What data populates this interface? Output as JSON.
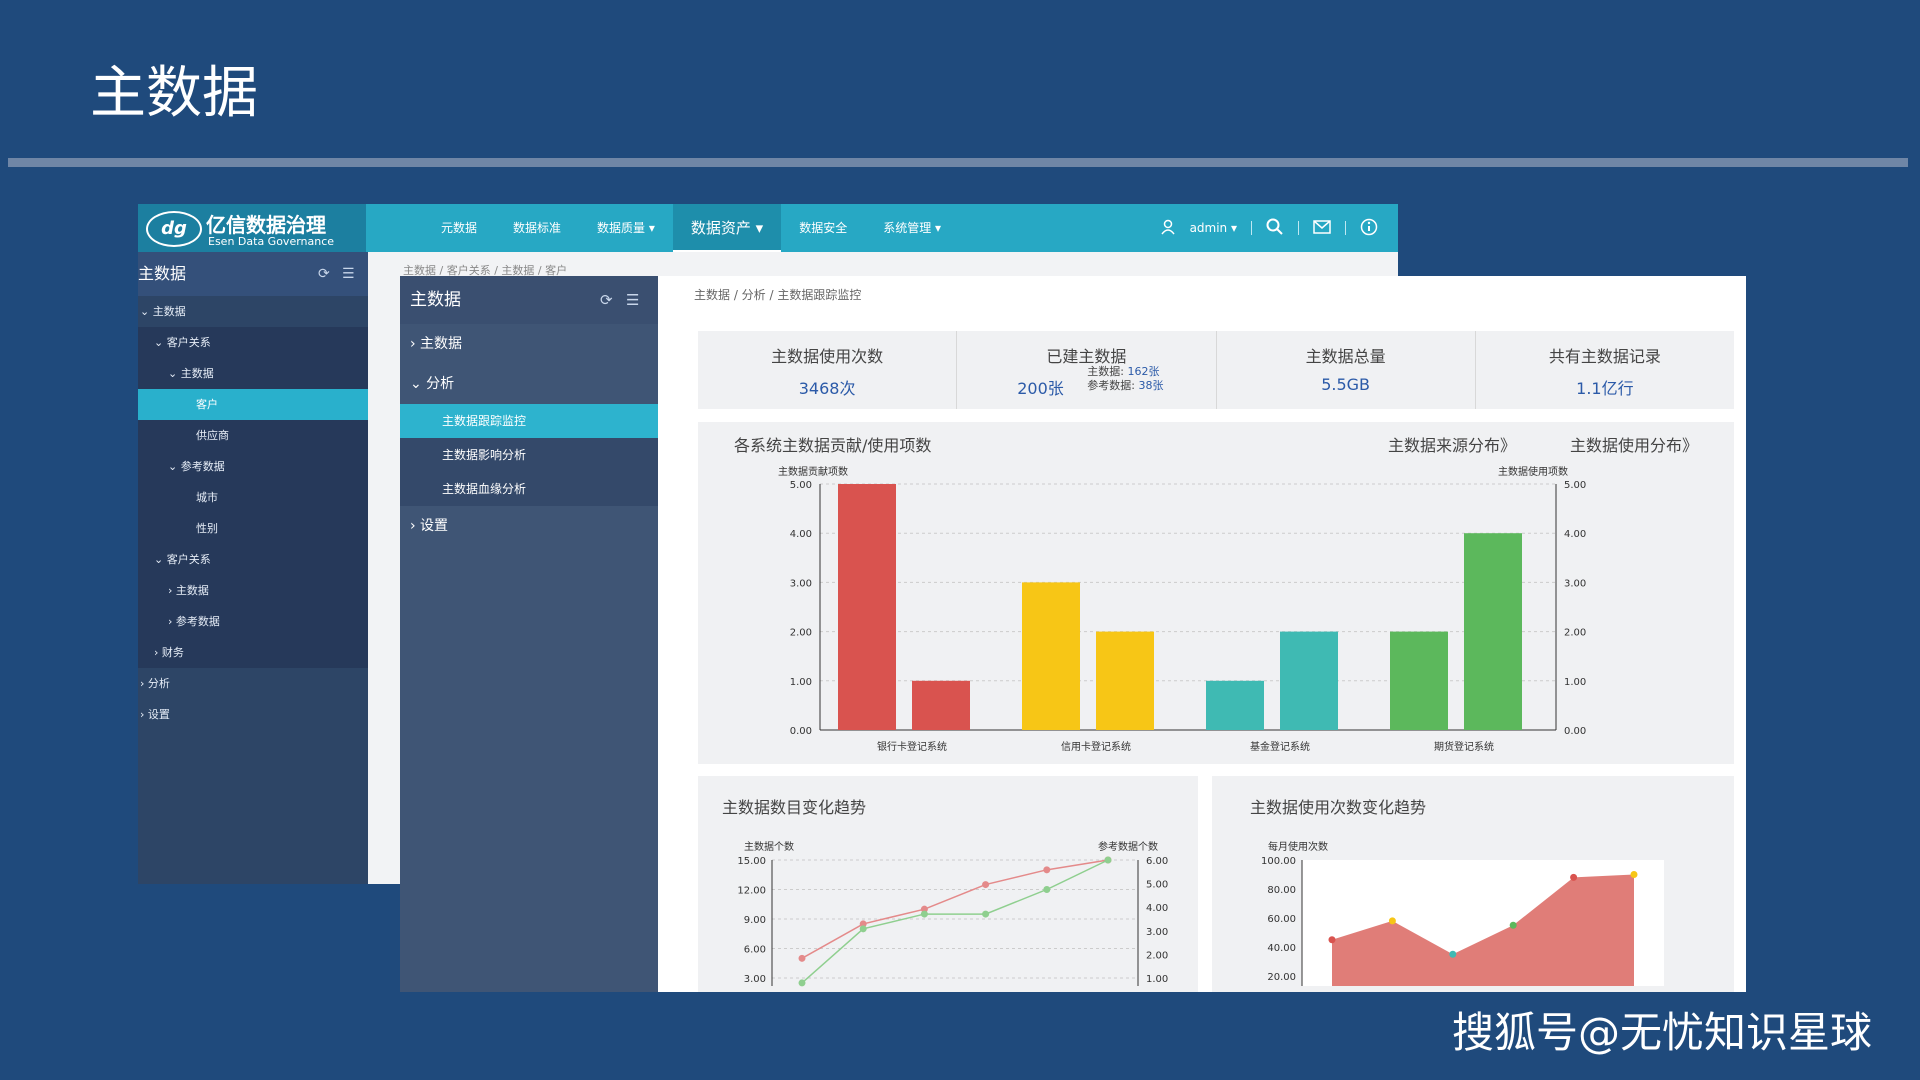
{
  "slide": {
    "title": "主数据",
    "watermark": "搜狐号@无忧知识星球"
  },
  "app": {
    "logo_mark": "dg",
    "logo_name": "亿信数据治理",
    "logo_sub": "Esen Data Governance",
    "nav": [
      "元数据",
      "数据标准",
      "数据质量 ▾",
      "数据资产 ▾",
      "数据安全",
      "系统管理 ▾"
    ],
    "nav_active_index": 3,
    "user": "admin ▾",
    "icons": [
      "user-icon",
      "search-icon",
      "mail-icon",
      "info-icon"
    ]
  },
  "back_sidebar": {
    "title": "主数据",
    "items": [
      {
        "label": "⌄ 主数据",
        "indent": 0
      },
      {
        "label": "⌄ 客户关系",
        "indent": 1
      },
      {
        "label": "⌄ 主数据",
        "indent": 2
      },
      {
        "label": "客户",
        "indent": 4,
        "selected": true
      },
      {
        "label": "供应商",
        "indent": 4
      },
      {
        "label": "⌄ 参考数据",
        "indent": 2
      },
      {
        "label": "城市",
        "indent": 4
      },
      {
        "label": "性别",
        "indent": 4
      },
      {
        "label": "⌄ 客户关系",
        "indent": 1
      },
      {
        "label": "› 主数据",
        "indent": 2
      },
      {
        "label": "› 参考数据",
        "indent": 2
      },
      {
        "label": "› 财务",
        "indent": 1
      },
      {
        "label": "› 分析",
        "indent": 0
      },
      {
        "label": "› 设置",
        "indent": 0
      }
    ],
    "breadcrumb": "主数据 / 客户关系 / 主数据 / 客户"
  },
  "front_sidebar": {
    "title": "主数据",
    "items": [
      "› 主数据",
      "⌄ 分析"
    ],
    "sub_items": [
      "主数据跟踪监控",
      "主数据影响分析",
      "主数据血缘分析"
    ],
    "selected_sub": 0,
    "last_item": "› 设置"
  },
  "main": {
    "breadcrumb": "主数据 / 分析 / 主数据跟踪监控",
    "stats": [
      {
        "label": "主数据使用次数",
        "value": "3468次"
      },
      {
        "label": "已建主数据",
        "value": "200张",
        "detail1_label": "主数据:",
        "detail1_value": "162张",
        "detail2_label": "参考数据:",
        "detail2_value": "38张"
      },
      {
        "label": "主数据总量",
        "value": "5.5GB"
      },
      {
        "label": "共有主数据记录",
        "value": "1.1亿行"
      }
    ],
    "bar_panel": {
      "title": "各系统主数据贡献/使用项数",
      "link1": "主数据来源分布》",
      "link2": "主数据使用分布》"
    },
    "line_panel": {
      "title": "主数据数目变化趋势"
    },
    "area_panel": {
      "title": "主数据使用次数变化趋势"
    }
  },
  "chart_data": [
    {
      "type": "bar",
      "ylabel": "主数据贡献项数",
      "y2label": "主数据使用项数",
      "ylim": [
        0,
        5
      ],
      "yticks": [
        "0.00",
        "1.00",
        "2.00",
        "3.00",
        "4.00",
        "5.00"
      ],
      "categories": [
        "银行卡登记系统",
        "信用卡登记系统",
        "基金登记系统",
        "期货登记系统"
      ],
      "series": [
        {
          "values": [
            5,
            3,
            1,
            2
          ]
        },
        {
          "values": [
            1,
            2,
            2,
            4
          ]
        }
      ],
      "colors": [
        "#d9534f",
        "#f7c616",
        "#3fbab3",
        "#5cb85c"
      ]
    },
    {
      "type": "line",
      "ylabel": "主数据个数",
      "y2label": "参考数据个数",
      "yticks": [
        "3.00",
        "6.00",
        "9.00",
        "12.00",
        "15.00"
      ],
      "y2ticks": [
        "1.00",
        "2.00",
        "3.00",
        "4.00",
        "5.00",
        "6.00"
      ],
      "ylim": [
        3,
        15
      ],
      "x": [
        1,
        2,
        3,
        4,
        5,
        6
      ],
      "series": [
        {
          "values": [
            5,
            8.5,
            10,
            12.5,
            14,
            15
          ],
          "color": "#e48a8a"
        },
        {
          "values": [
            2.5,
            8,
            9.5,
            9.5,
            12,
            15
          ],
          "color": "#8fcf8f"
        }
      ]
    },
    {
      "type": "area",
      "ylabel": "每月使用次数",
      "ylim": [
        20,
        100
      ],
      "yticks": [
        "20.00",
        "40.00",
        "60.00",
        "80.00",
        "100.00"
      ],
      "x": [
        1,
        2,
        3,
        4,
        5,
        6
      ],
      "values": [
        45,
        58,
        35,
        55,
        88,
        90
      ],
      "color": "#e07d78"
    }
  ]
}
